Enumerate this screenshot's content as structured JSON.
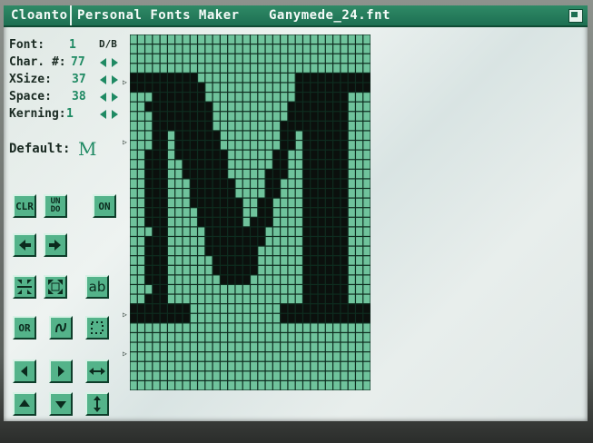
{
  "window": {
    "company": "Cloanto",
    "app_name": "Personal Fonts Maker",
    "file_name": "Ganymede_24.fnt"
  },
  "fields": [
    {
      "label": "Font:",
      "value": "1",
      "extra": "D/B"
    },
    {
      "label": "Char. #:",
      "value": "77"
    },
    {
      "label": "XSize:",
      "value": "37"
    },
    {
      "label": "Space:",
      "value": "38"
    },
    {
      "label": "Kerning:",
      "value": "1"
    }
  ],
  "default": {
    "label": "Default:",
    "char": "M"
  },
  "buttons": {
    "clr": "CLR",
    "undo": "UN DO",
    "on": "ON",
    "ab": "ab",
    "or": "OR"
  },
  "editor": {
    "character": "M",
    "cols": 32,
    "rows": 37
  },
  "colors": {
    "accent": "#1d6f52",
    "button": "#54b38a",
    "cell_off": "#6fc39c",
    "cell_on": "#0b100d",
    "grid_line": "#0e2c1f"
  }
}
